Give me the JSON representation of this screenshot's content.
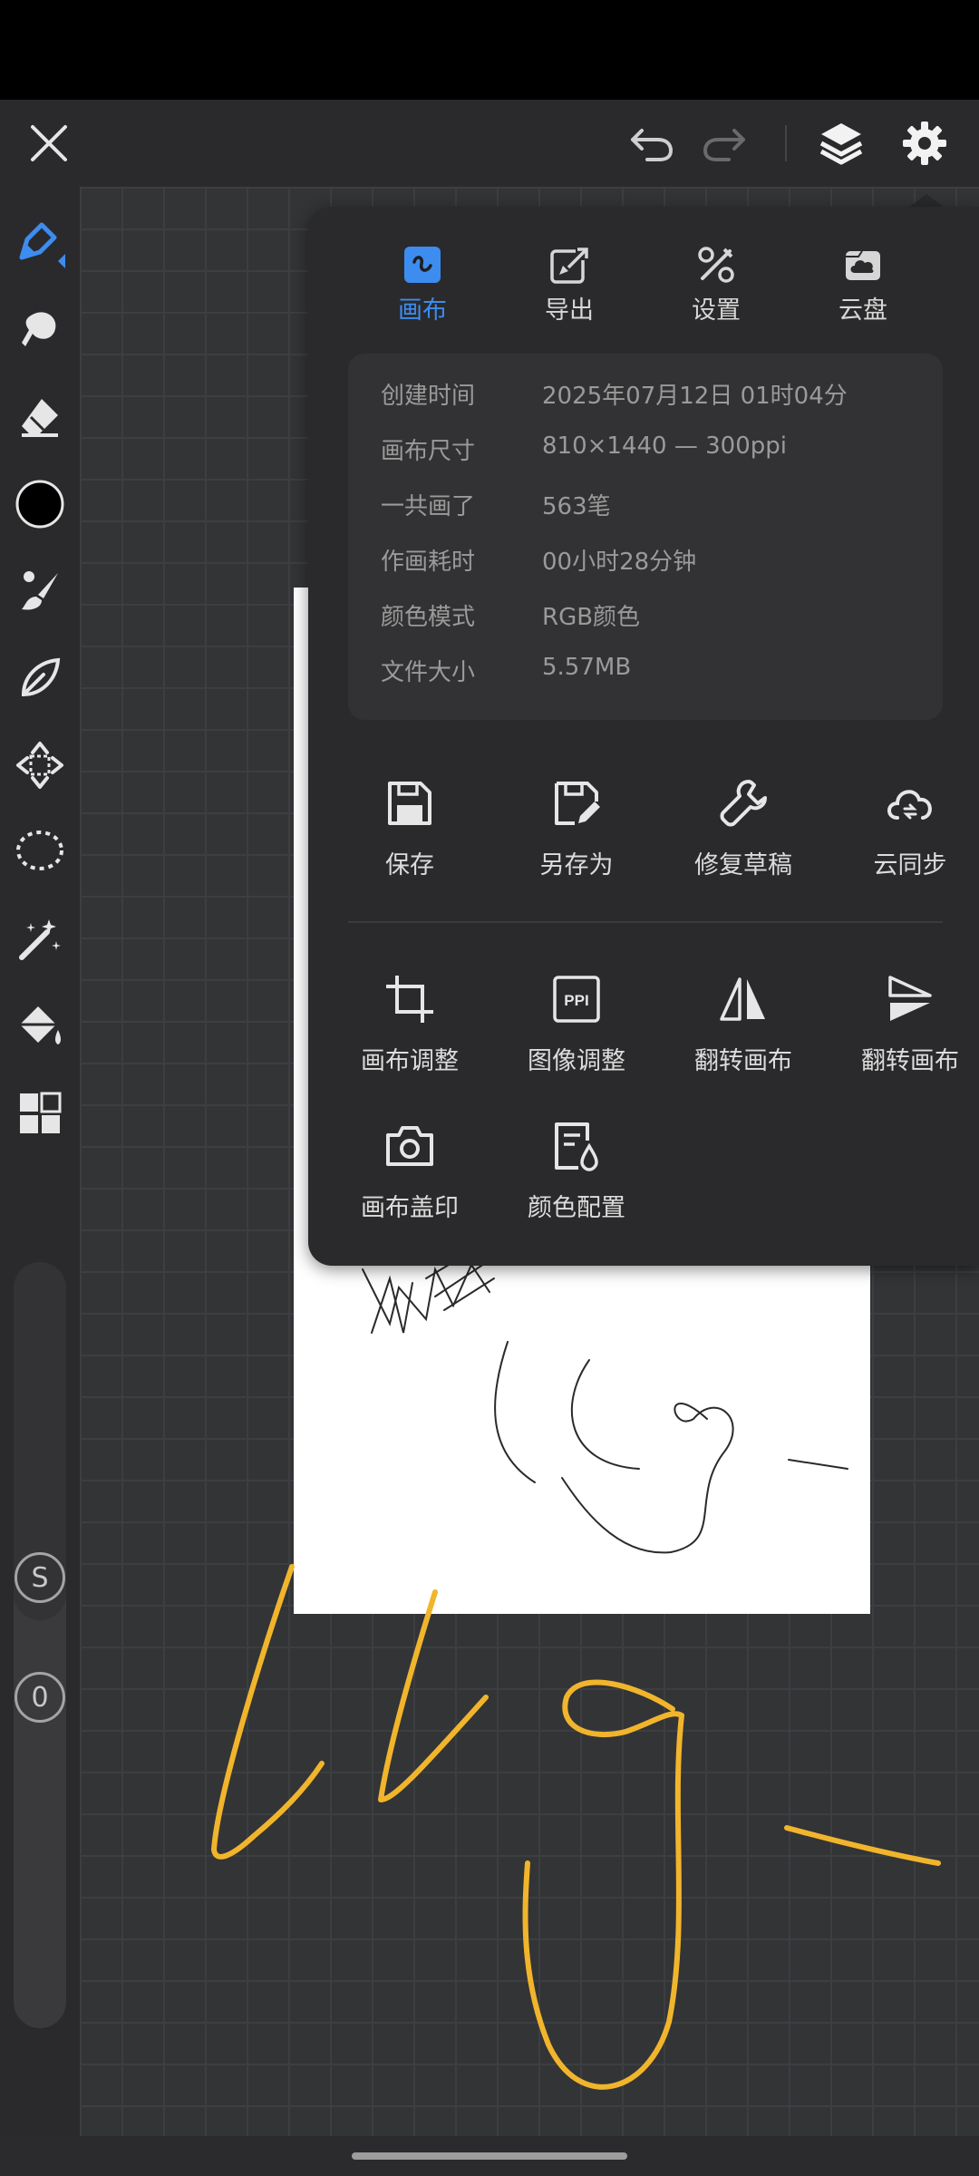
{
  "tabs": [
    {
      "label": "画布",
      "icon": "canvas-icon",
      "active": true
    },
    {
      "label": "导出",
      "icon": "export-icon",
      "active": false
    },
    {
      "label": "设置",
      "icon": "settings-tools-icon",
      "active": false
    },
    {
      "label": "云盘",
      "icon": "cloud-drive-icon",
      "active": false
    }
  ],
  "info": [
    {
      "key": "创建时间",
      "value": "2025年07月12日 01时04分"
    },
    {
      "key": "画布尺寸",
      "value": "810×1440 — 300ppi"
    },
    {
      "key": "一共画了",
      "value": "563笔"
    },
    {
      "key": "作画耗时",
      "value": "00小时28分钟"
    },
    {
      "key": "颜色模式",
      "value": "RGB颜色"
    },
    {
      "key": "文件大小",
      "value": "5.57MB"
    }
  ],
  "actions": [
    {
      "label": "保存",
      "icon": "save-icon"
    },
    {
      "label": "另存为",
      "icon": "save-as-icon"
    },
    {
      "label": "修复草稿",
      "icon": "repair-icon"
    },
    {
      "label": "云同步",
      "icon": "cloud-sync-icon"
    },
    {
      "label": "画布调整",
      "icon": "crop-icon"
    },
    {
      "label": "图像调整",
      "icon": "ppi-icon",
      "icon_text": "PPI"
    },
    {
      "label": "翻转画布",
      "icon": "flip-horizontal-icon"
    },
    {
      "label": "翻转画布",
      "icon": "flip-vertical-icon"
    },
    {
      "label": "画布盖印",
      "icon": "camera-icon"
    },
    {
      "label": "颜色配置",
      "icon": "color-config-icon"
    }
  ],
  "slider": {
    "top_label": "S",
    "bottom_label": "0"
  },
  "colors": {
    "accent": "#3d8cf0",
    "stroke_yellow": "#f1b52c",
    "panel": "#2a2a2c"
  }
}
